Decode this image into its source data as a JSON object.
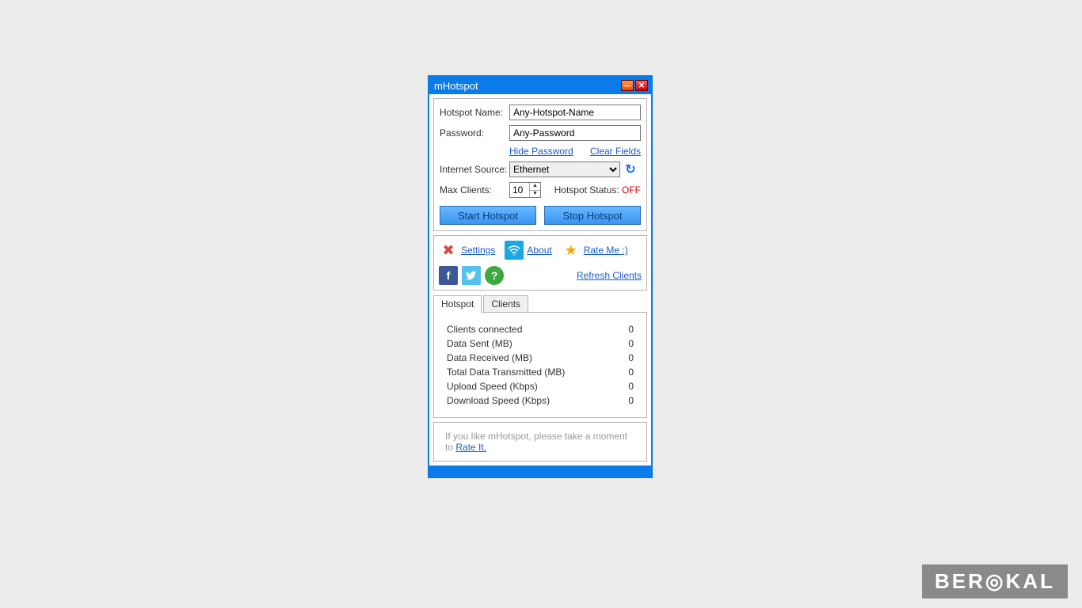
{
  "window": {
    "title": "mHotspot"
  },
  "form": {
    "hotspot_name_label": "Hotspot Name:",
    "hotspot_name_value": "Any-Hotspot-Name",
    "password_label": "Password:",
    "password_value": "Any-Password",
    "hide_password": "Hide Password",
    "clear_fields": "Clear Fields",
    "internet_source_label": "Internet Source:",
    "internet_source_value": "Ethernet",
    "max_clients_label": "Max Clients:",
    "max_clients_value": "10",
    "hotspot_status_label": "Hotspot Status:",
    "hotspot_status_value": "OFF",
    "start_btn": "Start Hotspot",
    "stop_btn": "Stop Hotspot"
  },
  "toolbar": {
    "settings": "Settings",
    "about": "About",
    "rate": "Rate Me :)",
    "refresh_clients": "Refresh Clients"
  },
  "tabs": {
    "hotspot": "Hotspot",
    "clients": "Clients"
  },
  "stats": [
    {
      "label": "Clients connected",
      "value": "0"
    },
    {
      "label": "Data Sent (MB)",
      "value": "0"
    },
    {
      "label": "Data Received (MB)",
      "value": "0"
    },
    {
      "label": "Total Data Transmitted (MB)",
      "value": "0"
    },
    {
      "label": "Upload Speed (Kbps)",
      "value": "0"
    },
    {
      "label": "Download Speed (Kbps)",
      "value": "0"
    }
  ],
  "footer": {
    "text": "If you like mHotspot, please take a moment to",
    "link": "Rate It."
  },
  "watermark": "BER◎KAL"
}
